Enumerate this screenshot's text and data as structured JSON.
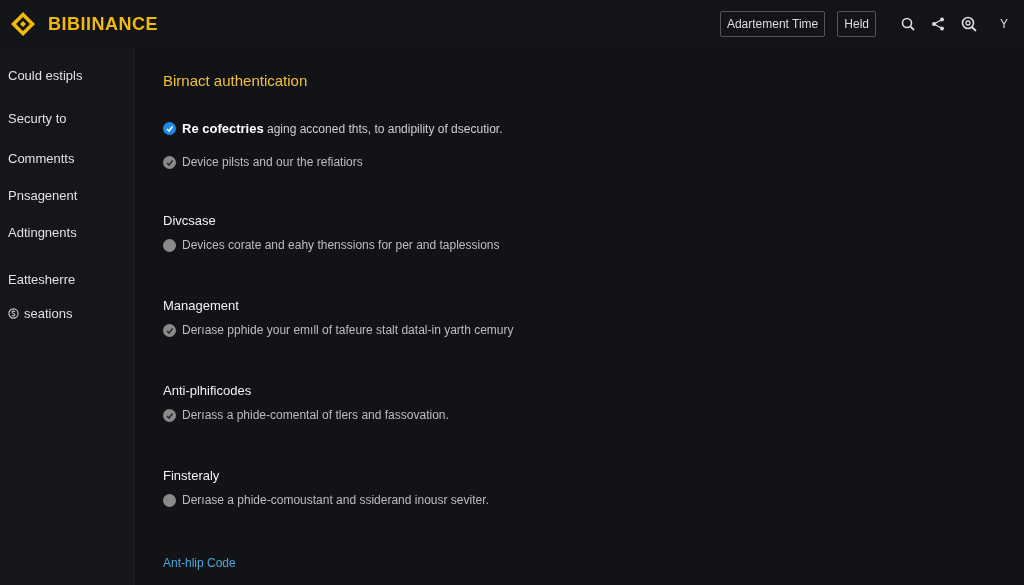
{
  "header": {
    "brand": "BIBIINANCE",
    "buttons": [
      "Adartement Time",
      "Held"
    ],
    "profile_label": "Y"
  },
  "sidebar": {
    "items": [
      {
        "label": "Could estipls",
        "has_icon": false
      },
      {
        "label": "Securty to",
        "has_icon": false
      },
      {
        "label": "Commentts",
        "has_icon": false
      },
      {
        "label": "Pnsagenent",
        "has_icon": false
      },
      {
        "label": "Adtingnents",
        "has_icon": false
      },
      {
        "label": "Eattesherre",
        "has_icon": false
      },
      {
        "label": "seations",
        "has_icon": true
      }
    ]
  },
  "title": "Birnact authentication",
  "sections": [
    {
      "options": [
        {
          "text": "**Re cofectries** aging acconed thts, to andipility of dsecutior.",
          "checked": true,
          "selected": true
        },
        {
          "text": "Device pilsts and our the refiatiors",
          "checked": true,
          "selected": false
        }
      ]
    },
    {
      "heading": "Divcsase",
      "options": [
        {
          "text": "Devices corate and eahy thenssions for per and taplessions",
          "checked": false,
          "selected": false
        }
      ]
    },
    {
      "heading": "Management",
      "options": [
        {
          "text": "Derıase pphide your emıll of tafeure stalt datal-in yarth cemury",
          "checked": true,
          "selected": false
        }
      ]
    },
    {
      "heading": "Anti-plhificodes",
      "options": [
        {
          "text": "Derıass a phide-comental of tlers and fassovation.",
          "checked": true,
          "selected": false
        }
      ]
    },
    {
      "heading": "Finsteraly",
      "options": [
        {
          "text": "Derıase a phide-comoustant and ssiderand inousr seviter.",
          "checked": false,
          "selected": false
        }
      ]
    }
  ],
  "link": "Ant-hlip Code"
}
